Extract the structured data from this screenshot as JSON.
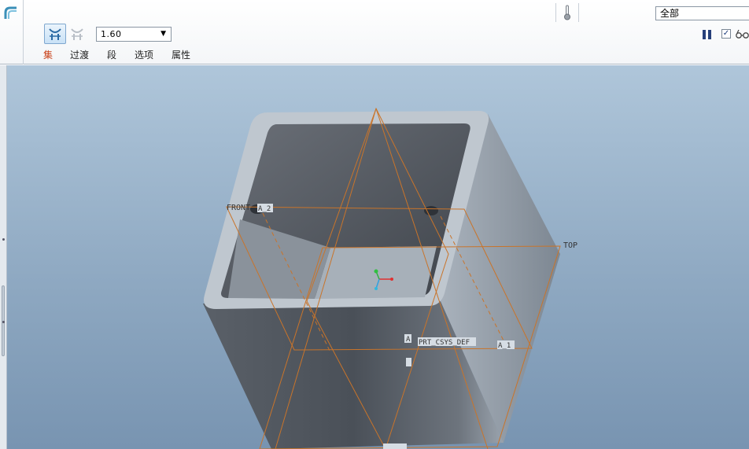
{
  "toolbar": {
    "radius_value": "1.60",
    "filter_value": "全部",
    "tabs": [
      {
        "label": "集",
        "active": true
      },
      {
        "label": "过渡",
        "active": false
      },
      {
        "label": "段",
        "active": false
      },
      {
        "label": "选项",
        "active": false
      },
      {
        "label": "属性",
        "active": false
      }
    ],
    "checkbox_checked": true
  },
  "icons": {
    "app": "round-tool-icon",
    "tool_a": "constant-round-icon",
    "tool_b": "variable-round-icon",
    "thermometer": "thermometer-icon",
    "pause": "pause-icon",
    "glasses": "glasses-preview-icon"
  },
  "viewport": {
    "labels": {
      "front": "FRONT",
      "top": "TOP",
      "axis_a2": "A_2",
      "axis_a1": "A_1",
      "csys": "PRT_CSYS_DEF",
      "a_marker": "A"
    }
  },
  "colors": {
    "accent_tab": "#c9421a",
    "datum_plane": "#c9742a",
    "bg_top": "#afc6da",
    "bg_bottom": "#7894b1"
  }
}
